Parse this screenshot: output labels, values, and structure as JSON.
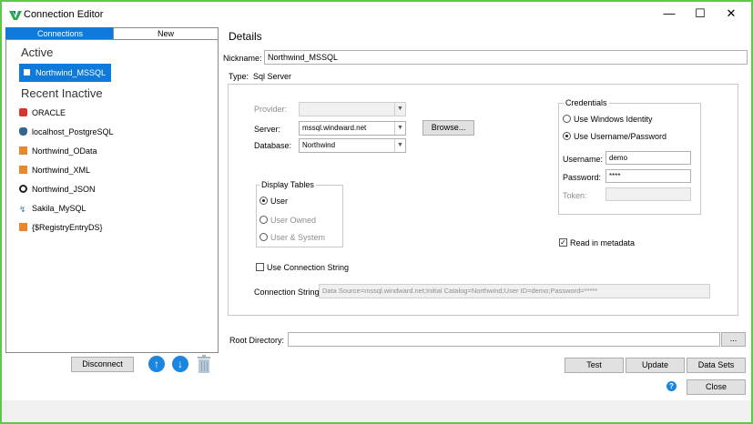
{
  "window": {
    "title": "Connection Editor",
    "minimize": "—",
    "maximize": "☐",
    "close": "✕"
  },
  "tabs": [
    {
      "label": "Connections",
      "active": true
    },
    {
      "label": "New",
      "active": false
    }
  ],
  "left": {
    "active_heading": "Active",
    "active_items": [
      {
        "label": "Northwind_MSSQL",
        "icon": "sqlserver-icon",
        "color": "#0f7ad9"
      }
    ],
    "inactive_heading": "Recent Inactive",
    "inactive_items": [
      {
        "label": "ORACLE",
        "icon": "oracle-icon",
        "color": "#d9362b"
      },
      {
        "label": "localhost_PostgreSQL",
        "icon": "postgresql-icon",
        "color": "#336791"
      },
      {
        "label": "Northwind_OData",
        "icon": "odata-icon",
        "color": "#e8872c"
      },
      {
        "label": "Northwind_XML",
        "icon": "xml-icon",
        "color": "#e8872c"
      },
      {
        "label": "Northwind_JSON",
        "icon": "json-icon",
        "color": "#222222"
      },
      {
        "label": "Sakila_MySQL",
        "icon": "mysql-icon",
        "color": "#4479a1"
      },
      {
        "label": "{$RegistryEntryDS}",
        "icon": "registry-icon",
        "color": "#e8872c"
      }
    ],
    "disconnect": "Disconnect"
  },
  "details": {
    "heading": "Details",
    "nickname_label": "Nickname:",
    "nickname_value": "Northwind_MSSQL",
    "type_label": "Type:",
    "type_value": "Sql Server",
    "provider_label": "Provider:",
    "provider_value": "",
    "server_label": "Server:",
    "server_value": "mssql.windward.net",
    "browse": "Browse...",
    "database_label": "Database:",
    "database_value": "Northwind",
    "display_tables": {
      "title": "Display Tables",
      "options": [
        {
          "label": "User",
          "selected": true
        },
        {
          "label": "User Owned",
          "selected": false
        },
        {
          "label": "User & System",
          "selected": false
        }
      ]
    },
    "credentials": {
      "title": "Credentials",
      "use_windows": "Use Windows Identity",
      "use_userpass": "Use Username/Password",
      "username_label": "Username:",
      "username_value": "demo",
      "password_label": "Password:",
      "password_value": "****",
      "token_label": "Token:",
      "token_value": ""
    },
    "read_in_metadata": "Read in metadata",
    "use_conn_string": "Use Connection String",
    "conn_string_label": "Connection String:",
    "conn_string_value": "Data Source=mssql.windward.net;Initial Catalog=Northwind;User ID=demo;Password=*****",
    "root_dir_label": "Root Directory:",
    "root_dir_value": "",
    "root_dir_browse": "..."
  },
  "actions": {
    "test": "Test",
    "update": "Update",
    "datasets": "Data Sets",
    "help": "?",
    "close": "Close"
  },
  "colors": {
    "accent": "#0f7ad9",
    "frame": "#5cc94a"
  }
}
